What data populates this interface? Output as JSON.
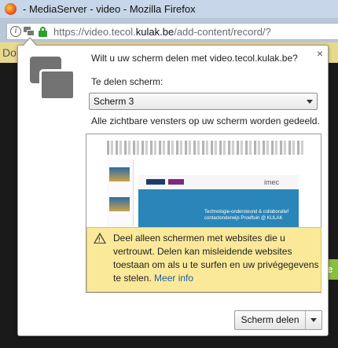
{
  "window": {
    "title": "- MediaServer - video - Mozilla Firefox"
  },
  "urlbar": {
    "url_prefix": "https://video.tecol.",
    "url_domain": "kulak.be",
    "url_path": "/add-content/record/?",
    "info_icon_glyph": "i"
  },
  "page": {
    "strip_text": "Do",
    "green_text": "e"
  },
  "popup": {
    "question": "Wilt u uw scherm delen met video.tecol.kulak.be?",
    "close_glyph": "×",
    "screen_label": "Te delen scherm:",
    "selected_screen": "Scherm 3",
    "visible_windows_text": "Alle zichtbare vensters op uw scherm worden gedeeld.",
    "preview": {
      "brand_text": "imec",
      "body_text": "Technologie-ondersteund & collaboratief contactonderwijs Proeftuin @ KULAK"
    },
    "warning": {
      "text": "Deel alleen schermen met websites die u vertrouwt. Delen kan misleidende websites toestaan om als u te surfen en uw privégegevens te stelen.",
      "link": "Meer info",
      "icon_glyph": "!"
    },
    "share_button_label": "Scherm delen"
  },
  "colors": {
    "titlebar": "#c7d6e8",
    "lock_green": "#2e9e2e",
    "warning_bg": "#fbe99a",
    "link": "#1e5ea8"
  }
}
